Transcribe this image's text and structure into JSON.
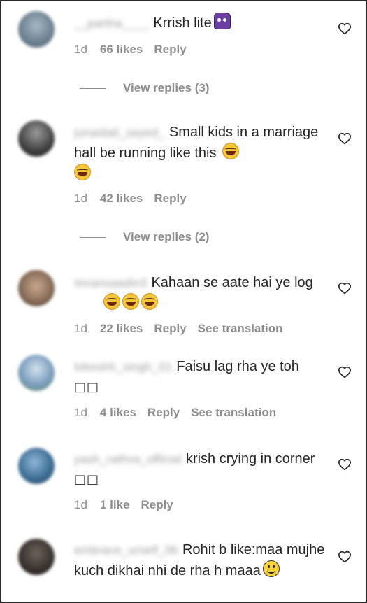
{
  "comments": [
    {
      "username": "__partha____",
      "text": "Krrish lite",
      "emoji": "alien",
      "time": "1d",
      "likes": "66 likes",
      "reply": "Reply",
      "avatar_color": "#6f8494",
      "view_replies": "View replies (3)"
    },
    {
      "username": "junaidali_sayed_",
      "text": "Small kids in a marriage hall be running like this",
      "emoji": "laugh",
      "emoji2": "laugh",
      "time": "1d",
      "likes": "42 likes",
      "reply": "Reply",
      "avatar_color": "#4a4a4a",
      "view_replies": "View replies (2)"
    },
    {
      "username": "imransaadin3",
      "text": "Kahaan se aate hai ye log",
      "time": "1d",
      "likes": "22 likes",
      "reply": "Reply",
      "see_translation": "See translation",
      "avatar_color": "#8b6f5a"
    },
    {
      "username": "lokeshh_singh_01",
      "text": "Faisu lag rha ye toh",
      "suffix": "□□",
      "time": "1d",
      "likes": "4 likes",
      "reply": "Reply",
      "see_translation": "See translation",
      "avatar_color": "#7d9ec0"
    },
    {
      "username": "yash_rathva_official",
      "text": "krish crying in corner",
      "suffix": "□□",
      "time": "1d",
      "likes": "1 like",
      "reply": "Reply",
      "avatar_color": "#3f6f95"
    },
    {
      "username": "embrace_urself_06",
      "text": "Rohit b like:maa mujhe kuch dikhai nhi de rha h maaa",
      "emoji": "smile",
      "avatar_color": "#3b3431"
    }
  ],
  "icons": {
    "like": "heart-outline-icon"
  }
}
